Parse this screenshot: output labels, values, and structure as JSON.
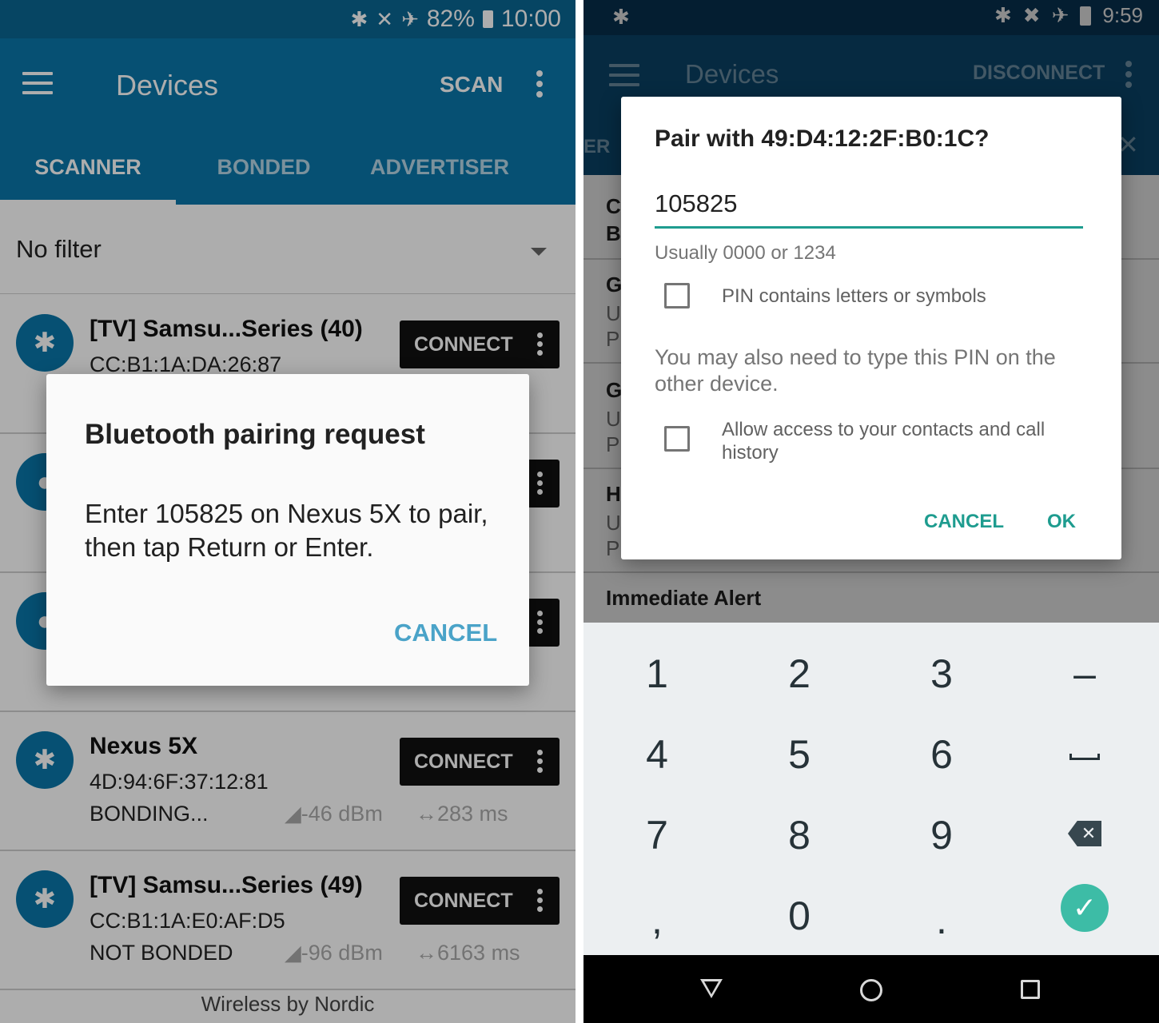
{
  "left": {
    "status": {
      "icons": [
        "bluetooth-icon",
        "vibrate-off-icon",
        "airplane-icon"
      ],
      "battery": "82%",
      "time": "10:00"
    },
    "appbar": {
      "title": "Devices",
      "scan": "SCAN",
      "menu_icon": "more-vert-icon"
    },
    "tabs": [
      "SCANNER",
      "BONDED",
      "ADVERTISER"
    ],
    "filter": {
      "label": "No filter"
    },
    "devices": [
      {
        "name": "[TV] Samsu...Series (40)",
        "mac": "CC:B1:1A:DA:26:87",
        "status": "",
        "rssi": "",
        "interval": "",
        "button": "CONNECT",
        "icon": "bluetooth-icon"
      },
      {
        "name": "",
        "mac": "",
        "status": "",
        "rssi": "",
        "interval": "",
        "button": "",
        "icon": "apple-icon"
      },
      {
        "name": "",
        "mac": "",
        "status": "",
        "rssi": "",
        "interval": "",
        "button": "",
        "icon": "apple-icon"
      },
      {
        "name": "Nexus 5X",
        "mac": "4D:94:6F:37:12:81",
        "status": "BONDING...",
        "rssi": "-46 dBm",
        "interval": "283 ms",
        "button": "CONNECT",
        "icon": "bluetooth-icon"
      },
      {
        "name": "[TV] Samsu...Series (49)",
        "mac": "CC:B1:1A:E0:AF:D5",
        "status": "NOT BONDED",
        "rssi": "-96 dBm",
        "interval": "6163 ms",
        "button": "CONNECT",
        "icon": "bluetooth-icon"
      }
    ],
    "footer": "Wireless by Nordic",
    "dialog": {
      "title": "Bluetooth pairing request",
      "message": "Enter 105825 on Nexus 5X to pair, then tap Return or Enter.",
      "cancel": "CANCEL"
    }
  },
  "right": {
    "status": {
      "time": "9:59",
      "icons": [
        "bluetooth-icon",
        "bluetooth-icon",
        "no-sim-icon",
        "airplane-icon",
        "battery-icon"
      ]
    },
    "appbar": {
      "title": "Devices",
      "disconnect": "DISCONNECT",
      "tab_peek": "ER"
    },
    "background_items": [
      {
        "text": "Co",
        "style": "b"
      },
      {
        "text": "Bo",
        "style": "b"
      },
      {
        "text": "G",
        "style": "b"
      },
      {
        "text": "U",
        "style": "g"
      },
      {
        "text": "P",
        "style": "g"
      },
      {
        "text": "G",
        "style": "b"
      },
      {
        "text": "U",
        "style": "g"
      },
      {
        "text": "P",
        "style": "g"
      },
      {
        "text": "H",
        "style": "b"
      },
      {
        "text": "U",
        "style": "g"
      },
      {
        "text": "P",
        "style": "g"
      },
      {
        "text": "Immediate Alert",
        "style": "b"
      }
    ],
    "dialog": {
      "title": "Pair with 49:D4:12:2F:B0:1C?",
      "pin_value": "105825",
      "hint": "Usually 0000 or 1234",
      "checkbox_pin_label": "PIN contains letters or symbols",
      "checkbox_pin_checked": false,
      "note": "You may also need to type this PIN on the other device.",
      "checkbox_contacts_label": "Allow access to your contacts and call history",
      "checkbox_contacts_checked": false,
      "cancel": "CANCEL",
      "ok": "OK"
    },
    "keypad": {
      "keys": [
        "1",
        "2",
        "3",
        "–",
        "4",
        "5",
        "6",
        "",
        "7",
        "8",
        "9",
        "",
        ",",
        "0",
        ".",
        ""
      ],
      "special_icons": {
        "space": "space-icon",
        "backspace": "backspace-icon",
        "done": "check-icon"
      }
    },
    "nav": [
      "back-icon",
      "home-icon",
      "recents-icon"
    ]
  }
}
